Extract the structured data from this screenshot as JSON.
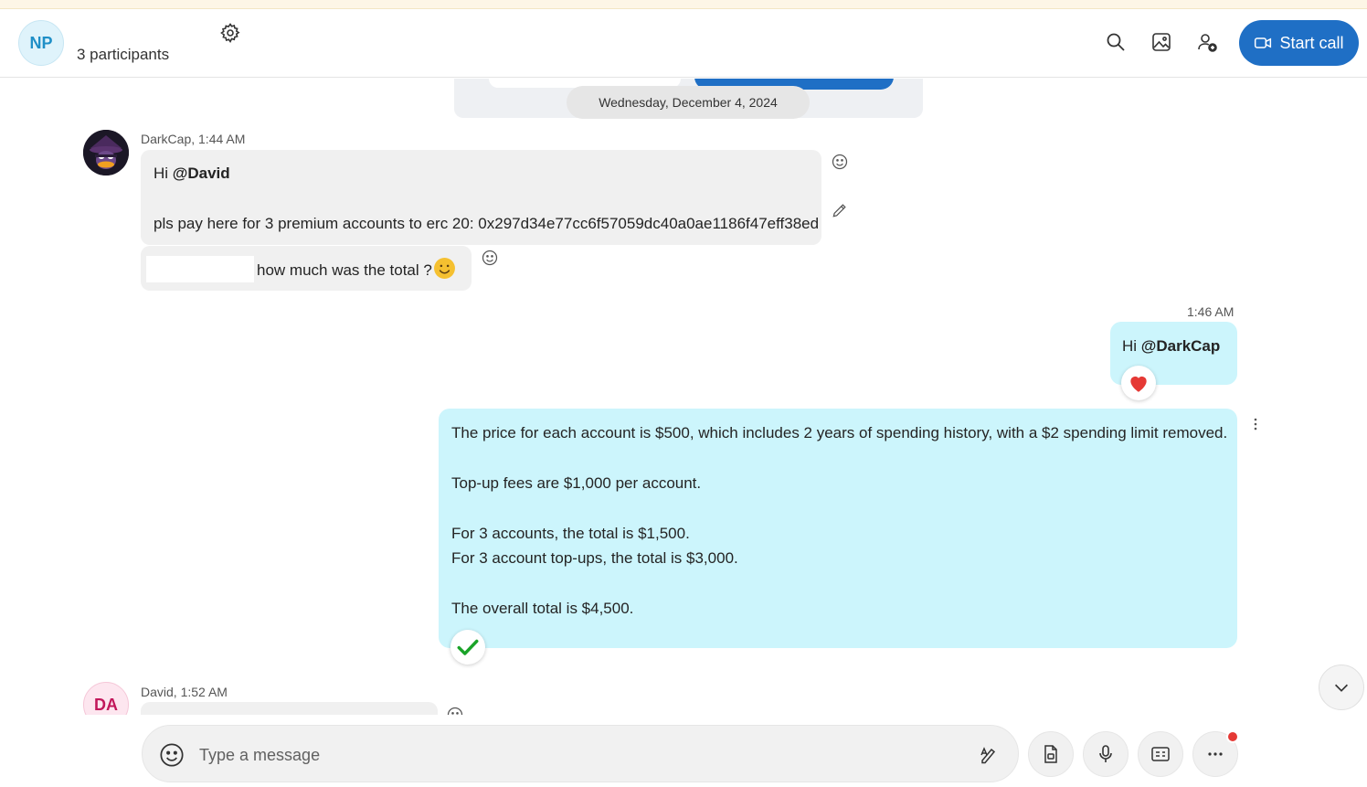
{
  "header": {
    "avatar_initials": "NP",
    "participants": "3 participants",
    "start_call": "Start call"
  },
  "date_separator": "Wednesday, December 4, 2024",
  "messages": {
    "darkcap": {
      "sender": "DarkCap, 1:44 AM",
      "line1_prefix": "Hi ",
      "line1_mention": "@David",
      "line2": "pls pay here for 3 premium accounts to erc 20: 0x297d34e77cc6f57059dc40a0ae1186f47eff38ed",
      "line3": "how much was the total ?"
    },
    "me": {
      "time": "1:46 AM",
      "hi_prefix": "Hi ",
      "hi_mention": "@DarkCap",
      "reply_lines": [
        "The price for each account is $500, which includes 2 years of spending history, with a $2 spending limit removed.",
        "Top-up fees are $1,000 per account.",
        "For 3 accounts, the total is $1,500.",
        "For 3 account top-ups, the total is $3,000.",
        "The overall total is $4,500."
      ]
    },
    "david": {
      "sender": "David, 1:52 AM",
      "avatar_initials": "DA"
    }
  },
  "composer": {
    "placeholder": "Type a message"
  },
  "colors": {
    "accent": "#1f6fc5",
    "outgoing_bubble": "#ccf5fc",
    "incoming_bubble": "#f0f0f0",
    "heart": "#e53935",
    "check": "#1aa328",
    "notification_dot": "#e53935"
  }
}
